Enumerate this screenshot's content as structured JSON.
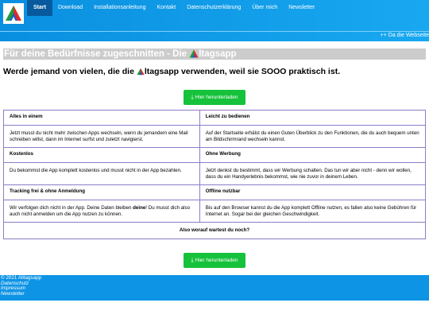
{
  "nav": {
    "items": [
      "Start",
      "Download",
      "Installationsanleitung",
      "Kontakt",
      "Datenschutzerklärung",
      "Über mich",
      "Newsletter"
    ]
  },
  "ticker": "++ Da die Webseite",
  "banner": {
    "prefix": "Für deine Bedürfnisse zugeschnitten - Die ",
    "suffix": "ltagsapp"
  },
  "headline": {
    "prefix": "Werde jemand von vielen, die die ",
    "suffix": "ltagsapp verwenden, weil sie SOOO praktisch ist."
  },
  "download_label": "Hier herunterladen",
  "features": [
    {
      "title": "Alles in einem",
      "text": "Jetzt musst du nicht mehr zwischen Apps wechseln, wenn du jemandem eine Mail schreiben willst, dann im Internet surfst und zuletzt navigierst."
    },
    {
      "title": "Leicht zu bedienen",
      "text": "Auf der Startseite erhälst du einen Guten Überblick zu den Funktionen, die du auch bequem unten am Bildschirmrand wechseln kannst."
    },
    {
      "title": "Kostenlos",
      "text": "Du bekommst die App komplett kostenlos und musst nicht in der App bezahlen."
    },
    {
      "title": "Ohne Werbung",
      "text": "Jetzt denkst du bestimmt, dass wir Werbung schalten. Das tun wir aber nicht - denn wir wollen, dass du ein Handyerlebnis bekommst, wie nie zuvor in deinem Leben."
    },
    {
      "title": "Tracking frei & ohne Anmeldung",
      "text_before": "Wir verfolgen dich nicht in der App. Deine Daten bleiben ",
      "text_bold": "deine",
      "text_after": "! Du musst dich also auch nicht anmelden um die App nutzen zu können."
    },
    {
      "title": "Offline nutzbar",
      "text": "Bis auf den Browser kannst du die App komplett Offline nutzen, es fallen also keine Gebühren für Internet an. Sogar bei der gleichen Geschwindigkeit."
    }
  ],
  "question": "Also worauf wartest du noch?",
  "footer": {
    "copyright": "© 2021 Alltagsapp",
    "links": [
      "Datenschutz",
      "Impressum",
      "Newsletter"
    ]
  },
  "colors": {
    "header": "#0a8fe0",
    "nav_active": "#075a9e",
    "button": "#16c23b",
    "table_border": "#8d7cc7",
    "banner": "#cccccc",
    "footer": "#0d94e5"
  },
  "icons": {
    "logo": "alltagsapp-logo",
    "download": "download-icon"
  }
}
